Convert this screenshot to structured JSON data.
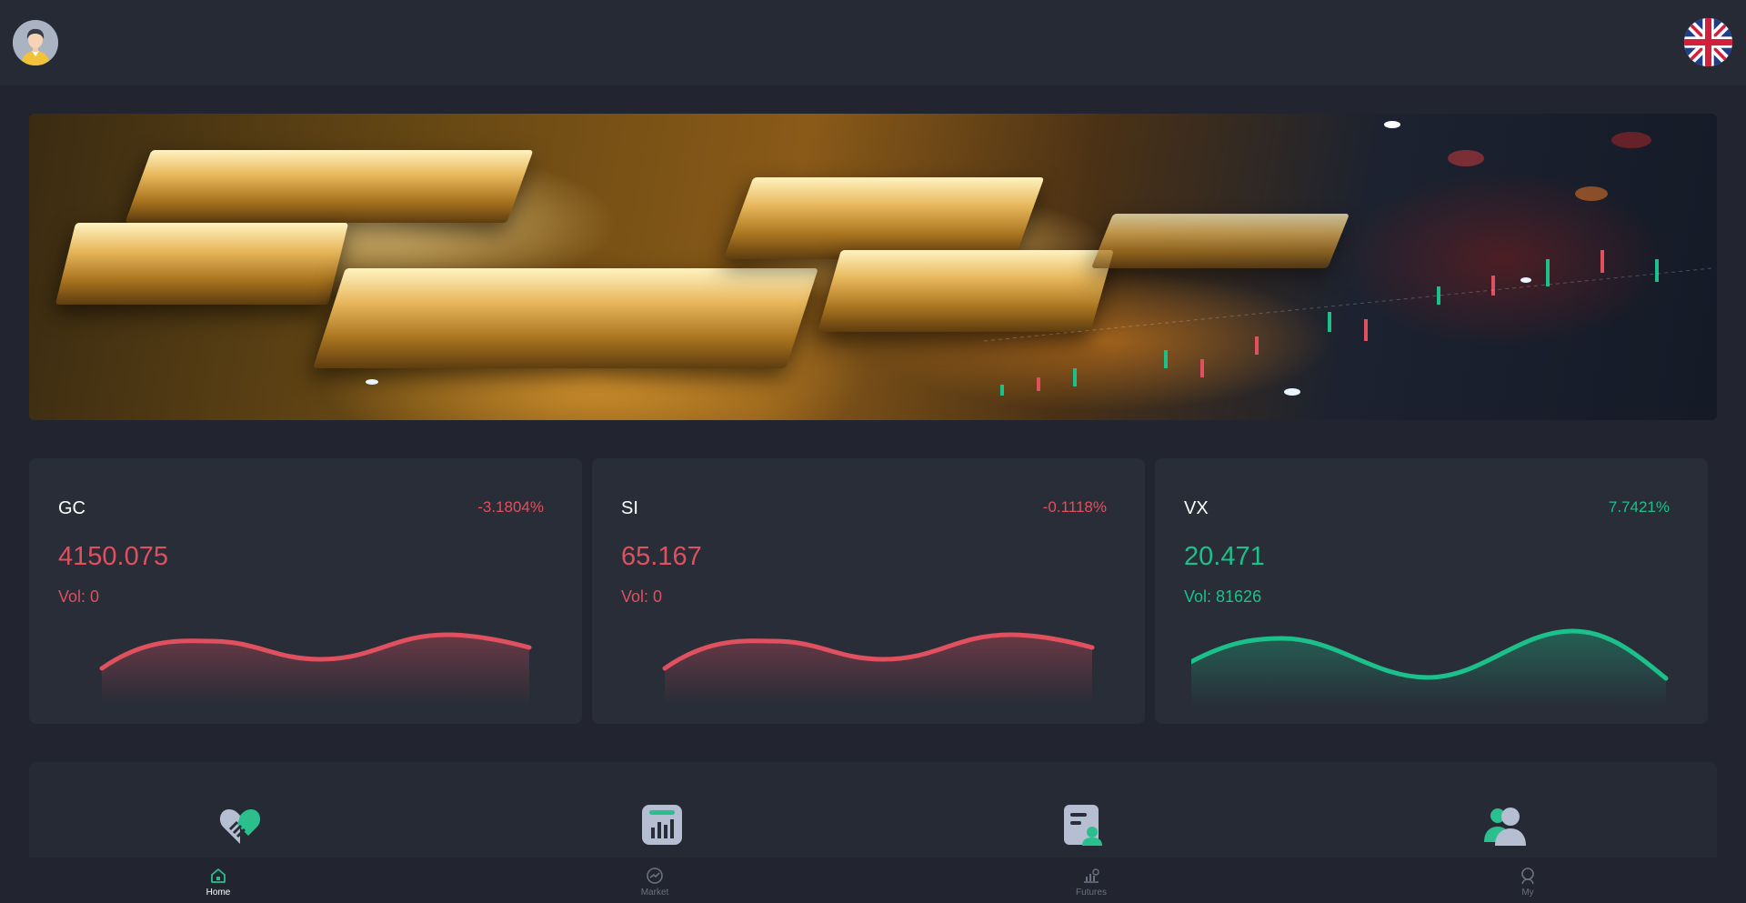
{
  "header": {
    "avatar_icon": "user-avatar-icon",
    "language_icon": "uk-flag-icon"
  },
  "banner": {
    "image": "gold-bars-trading-banner"
  },
  "tickers": [
    {
      "symbol": "GC",
      "change": "-3.1804%",
      "price": "4150.075",
      "volume": "Vol: 0",
      "trend": "down",
      "color": "#e0505e"
    },
    {
      "symbol": "SI",
      "change": "-0.1118%",
      "price": "65.167",
      "volume": "Vol: 0",
      "trend": "down",
      "color": "#e0505e"
    },
    {
      "symbol": "VX",
      "change": "7.7421%",
      "price": "20.471",
      "volume": "Vol: 81626",
      "trend": "up",
      "color": "#1cc08a"
    }
  ],
  "shortcuts": [
    {
      "icon": "handshake-heart-icon"
    },
    {
      "icon": "report-chart-icon"
    },
    {
      "icon": "document-user-icon"
    },
    {
      "icon": "users-group-icon"
    }
  ],
  "tabbar": [
    {
      "label": "Home",
      "icon": "home-icon",
      "active": true
    },
    {
      "label": "Market",
      "icon": "market-gauge-icon",
      "active": false
    },
    {
      "label": "Futures",
      "icon": "futures-chart-icon",
      "active": false
    },
    {
      "label": "My",
      "icon": "profile-icon",
      "active": false
    }
  ],
  "colors": {
    "background": "#22252f",
    "card": "#292d38",
    "down": "#e0505e",
    "up": "#1cc08a",
    "accent": "#2bbf8e"
  }
}
